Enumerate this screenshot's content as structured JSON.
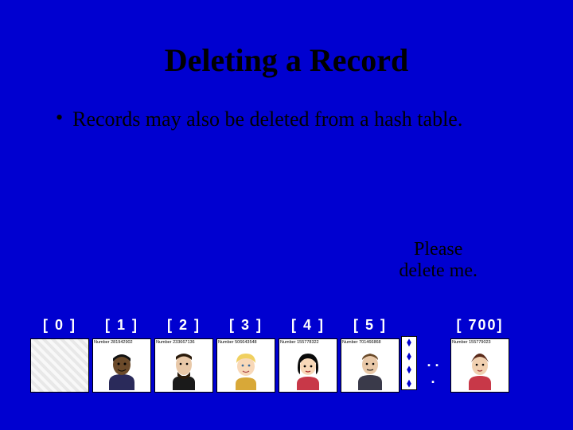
{
  "title": "Deleting a Record",
  "bullet": "Records may also be deleted from a hash table.",
  "callout_line1": "Please",
  "callout_line2": "delete me.",
  "ellipsis": ". . .",
  "cells": [
    {
      "index": "[ 0 ]",
      "empty": true,
      "label": ""
    },
    {
      "index": "[ 1 ]",
      "empty": false,
      "label": "Number 281942902"
    },
    {
      "index": "[ 2 ]",
      "empty": false,
      "label": "Number 233667136"
    },
    {
      "index": "[ 3 ]",
      "empty": false,
      "label": "Number 506643548"
    },
    {
      "index": "[ 4 ]",
      "empty": false,
      "label": "Number 155778322"
    },
    {
      "index": "[ 5 ]",
      "empty": false,
      "label": "Number 701466868"
    }
  ],
  "last_cell": {
    "index": "[ 700]",
    "empty": false,
    "label": "Number 155779023"
  }
}
